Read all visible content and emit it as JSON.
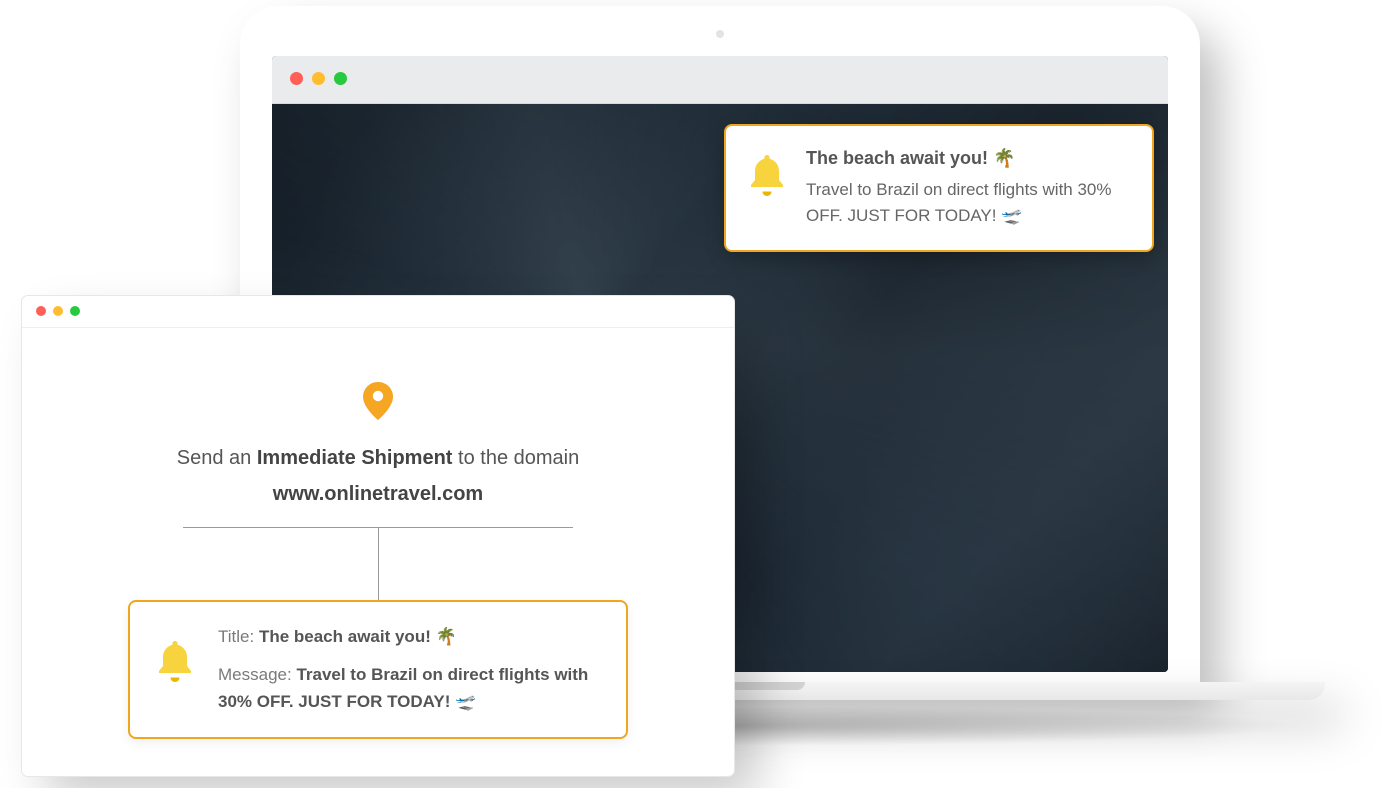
{
  "laptop": {
    "notification": {
      "title": "The beach await you! 🌴",
      "message": "Travel to Brazil on direct flights with 30% OFF. JUST FOR TODAY! 🛫"
    }
  },
  "editor": {
    "lead_prefix": "Send an ",
    "lead_bold": "Immediate Shipment",
    "lead_suffix": " to the domain",
    "domain": "www.onlinetravel.com",
    "compose": {
      "title_label": "Title: ",
      "title_value": "The beach await you! 🌴",
      "message_label": "Message: ",
      "message_value": "Travel to Brazil on direct flights with 30% OFF. JUST FOR TODAY! 🛫"
    }
  }
}
